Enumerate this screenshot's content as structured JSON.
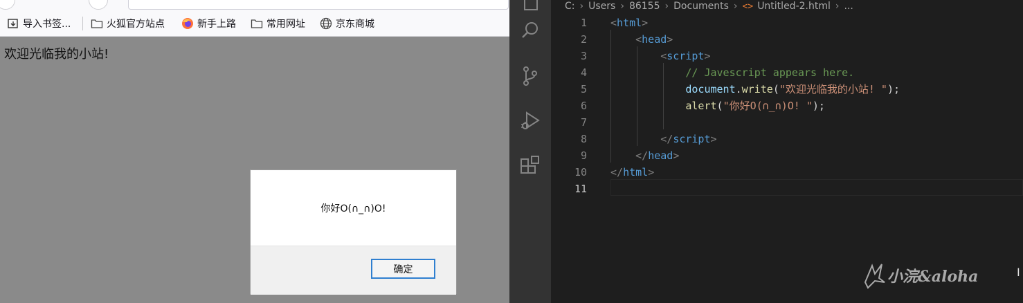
{
  "browser": {
    "bookmarks": [
      {
        "label": "导入书签...",
        "icon": "import-icon"
      },
      {
        "label": "火狐官方站点",
        "icon": "folder-icon"
      },
      {
        "label": "新手上路",
        "icon": "firefox-icon"
      },
      {
        "label": "常用网址",
        "icon": "folder-icon"
      },
      {
        "label": "京东商城",
        "icon": "globe-icon"
      }
    ],
    "page_text": "欢迎光临我的小站!",
    "alert": {
      "message": "你好O(∩_∩)O!",
      "ok_label": "确定"
    }
  },
  "vscode": {
    "breadcrumb": [
      "C:",
      "Users",
      "86155",
      "Documents",
      "Untitled-2.html",
      "..."
    ],
    "current_line": 11,
    "code": [
      {
        "n": "1",
        "tokens": [
          [
            "<",
            "punct"
          ],
          [
            "html",
            "tag"
          ],
          [
            ">",
            "punct"
          ]
        ]
      },
      {
        "n": "2",
        "tokens": [
          [
            "    ",
            "plain"
          ],
          [
            "<",
            "punct"
          ],
          [
            "head",
            "tag"
          ],
          [
            ">",
            "punct"
          ]
        ]
      },
      {
        "n": "3",
        "tokens": [
          [
            "        ",
            "plain"
          ],
          [
            "<",
            "punct"
          ],
          [
            "script",
            "tag"
          ],
          [
            ">",
            "punct"
          ]
        ]
      },
      {
        "n": "4",
        "tokens": [
          [
            "            ",
            "plain"
          ],
          [
            "// Javescript appears here.",
            "cmt"
          ]
        ]
      },
      {
        "n": "5",
        "tokens": [
          [
            "            ",
            "plain"
          ],
          [
            "document",
            "var"
          ],
          [
            ".",
            "plain"
          ],
          [
            "write",
            "fn"
          ],
          [
            "(",
            "plain"
          ],
          [
            "\"欢迎光临我的小站! \"",
            "str"
          ],
          [
            ");",
            "plain"
          ]
        ]
      },
      {
        "n": "6",
        "tokens": [
          [
            "            ",
            "plain"
          ],
          [
            "alert",
            "fn"
          ],
          [
            "(",
            "plain"
          ],
          [
            "\"你好O(∩_∩)O! \"",
            "str"
          ],
          [
            ");",
            "plain"
          ]
        ]
      },
      {
        "n": "7",
        "tokens": []
      },
      {
        "n": "8",
        "tokens": [
          [
            "        ",
            "plain"
          ],
          [
            "</",
            "punct"
          ],
          [
            "script",
            "tag"
          ],
          [
            ">",
            "punct"
          ]
        ]
      },
      {
        "n": "9",
        "tokens": [
          [
            "    ",
            "plain"
          ],
          [
            "</",
            "punct"
          ],
          [
            "head",
            "tag"
          ],
          [
            ">",
            "punct"
          ]
        ]
      },
      {
        "n": "10",
        "tokens": [
          [
            "</",
            "punct"
          ],
          [
            "html",
            "tag"
          ],
          [
            ">",
            "punct"
          ]
        ]
      },
      {
        "n": "11",
        "tokens": []
      }
    ],
    "activity_icons": [
      "explorer-icon",
      "search-icon",
      "source-control-icon",
      "run-debug-icon",
      "extensions-icon"
    ]
  },
  "watermark": "小浣&aloha"
}
